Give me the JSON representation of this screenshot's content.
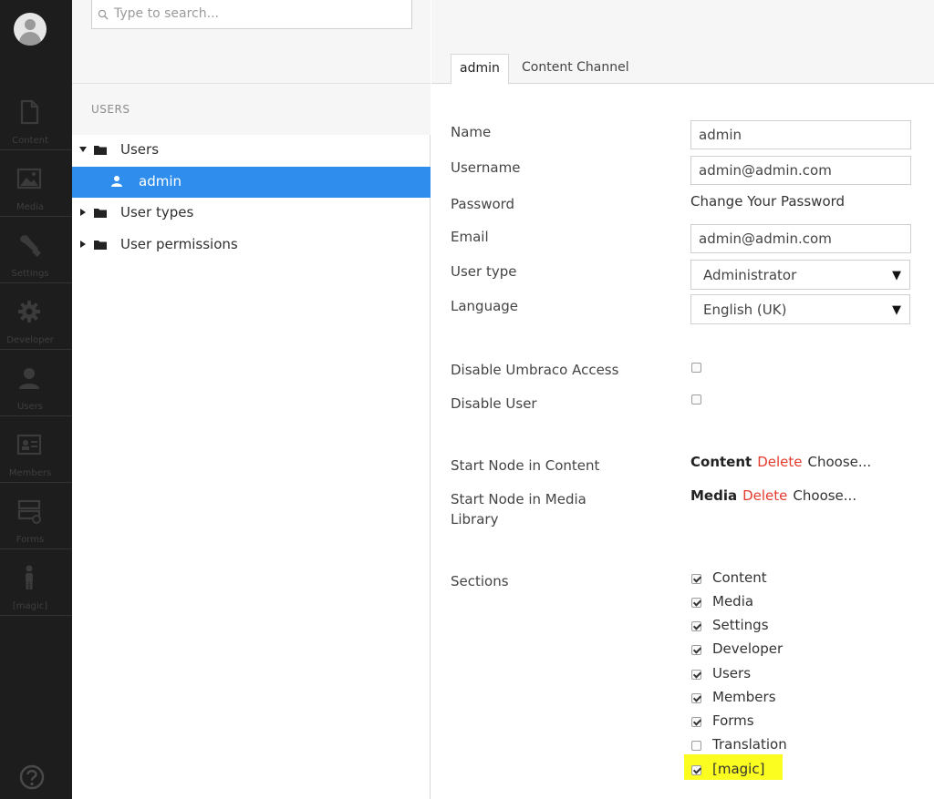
{
  "rail": {
    "sections": [
      {
        "label": "Content",
        "icon": "document-icon"
      },
      {
        "label": "Media",
        "icon": "image-icon"
      },
      {
        "label": "Settings",
        "icon": "wrench-icon"
      },
      {
        "label": "Developer",
        "icon": "gear-icon"
      },
      {
        "label": "Users",
        "icon": "user-icon"
      },
      {
        "label": "Members",
        "icon": "id-card-icon"
      },
      {
        "label": "Forms",
        "icon": "forms-icon"
      },
      {
        "label": "[magic]",
        "icon": "person-icon"
      }
    ],
    "help_icon": "help-icon"
  },
  "tree": {
    "search_placeholder": "Type to search...",
    "section_title": "USERS",
    "nodes": [
      {
        "label": "Users",
        "expanded": true
      },
      {
        "label": "admin",
        "selected": true
      },
      {
        "label": "User types",
        "expanded": false
      },
      {
        "label": "User permissions",
        "expanded": false
      }
    ]
  },
  "editor": {
    "tabs": [
      {
        "label": "admin",
        "active": true
      },
      {
        "label": "Content Channel",
        "active": false
      }
    ],
    "fields": {
      "name": {
        "label": "Name",
        "value": "admin"
      },
      "username": {
        "label": "Username",
        "value": "admin@admin.com"
      },
      "password": {
        "label": "Password",
        "value": "Change Your Password"
      },
      "email": {
        "label": "Email",
        "value": "admin@admin.com"
      },
      "user_type": {
        "label": "User type",
        "value": "Administrator"
      },
      "language": {
        "label": "Language",
        "value": "English (UK)"
      },
      "disable_umbraco": {
        "label": "Disable Umbraco Access",
        "checked": false
      },
      "disable_user": {
        "label": "Disable User",
        "checked": false
      },
      "start_content": {
        "label": "Start Node in Content",
        "node": "Content",
        "delete": "Delete",
        "choose": "Choose..."
      },
      "start_media": {
        "label": "Start Node in Media",
        "label2": "Library",
        "node": "Media",
        "delete": "Delete",
        "choose": "Choose..."
      },
      "sections_label": "Sections"
    },
    "sections": [
      {
        "label": "Content",
        "checked": true
      },
      {
        "label": "Media",
        "checked": true
      },
      {
        "label": "Settings",
        "checked": true
      },
      {
        "label": "Developer",
        "checked": true
      },
      {
        "label": "Users",
        "checked": true
      },
      {
        "label": "Members",
        "checked": true
      },
      {
        "label": "Forms",
        "checked": true
      },
      {
        "label": "Translation",
        "checked": false
      },
      {
        "label": "[magic]",
        "checked": true,
        "highlighted": true
      }
    ],
    "highlight_color": "#fbfc20",
    "delete_color": "#e43b2e",
    "selection_color": "#2f8ded"
  }
}
